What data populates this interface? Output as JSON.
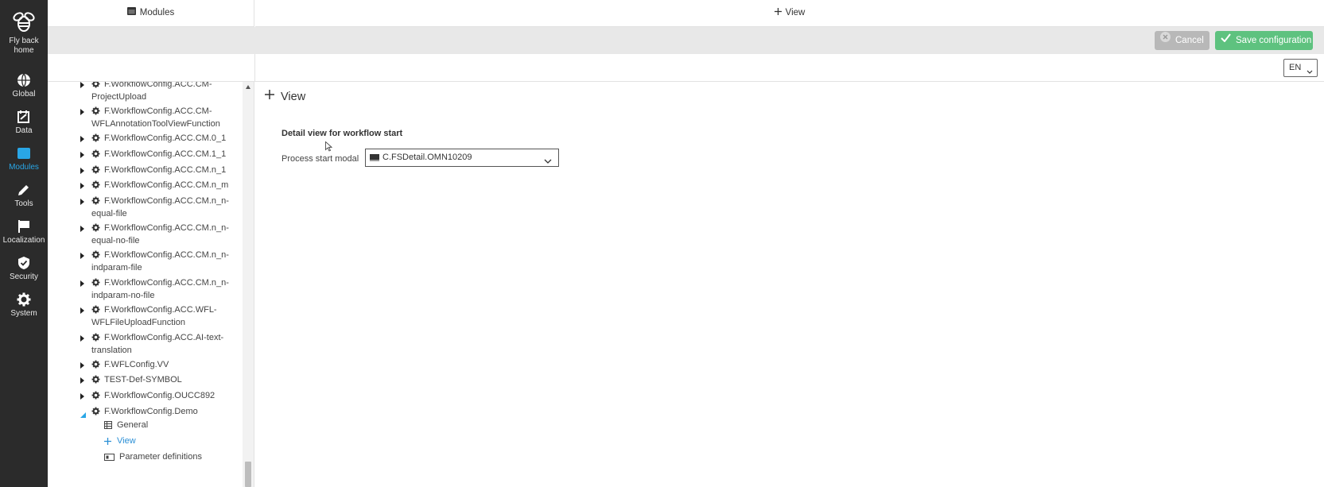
{
  "rail": {
    "items": [
      {
        "label": "Fly back home",
        "icon": "bee-logo-icon"
      },
      {
        "label": "Global",
        "icon": "globe-icon"
      },
      {
        "label": "Data",
        "icon": "edit-document-icon"
      },
      {
        "label": "Modules",
        "icon": "modules-window-icon",
        "active": true
      },
      {
        "label": "Tools",
        "icon": "pencil-icon"
      },
      {
        "label": "Localization",
        "icon": "flag-icon"
      },
      {
        "label": "Security",
        "icon": "shield-icon"
      },
      {
        "label": "System",
        "icon": "gear-icon"
      }
    ]
  },
  "tabs": {
    "left": "Modules",
    "right": "View"
  },
  "actions": {
    "cancel": "Cancel",
    "save": "Save configuration"
  },
  "language": "EN",
  "tree": {
    "nodes": [
      {
        "lines": [
          "F.WorkflowConfig.ACC.CM-",
          "ProjectUpload"
        ]
      },
      {
        "lines": [
          "F.WorkflowConfig.ACC.CM-",
          "WFLAnnotationToolViewFunction"
        ]
      },
      {
        "lines": [
          "F.WorkflowConfig.ACC.CM.0_1"
        ]
      },
      {
        "lines": [
          "F.WorkflowConfig.ACC.CM.1_1"
        ]
      },
      {
        "lines": [
          "F.WorkflowConfig.ACC.CM.n_1"
        ]
      },
      {
        "lines": [
          "F.WorkflowConfig.ACC.CM.n_m"
        ]
      },
      {
        "lines": [
          "F.WorkflowConfig.ACC.CM.n_n-",
          "equal-file"
        ]
      },
      {
        "lines": [
          "F.WorkflowConfig.ACC.CM.n_n-",
          "equal-no-file"
        ]
      },
      {
        "lines": [
          "F.WorkflowConfig.ACC.CM.n_n-",
          "indparam-file"
        ]
      },
      {
        "lines": [
          "F.WorkflowConfig.ACC.CM.n_n-",
          "indparam-no-file"
        ]
      },
      {
        "lines": [
          "F.WorkflowConfig.ACC.WFL-",
          "WFLFileUploadFunction"
        ]
      },
      {
        "lines": [
          "F.WorkflowConfig.ACC.AI-text-",
          "translation"
        ]
      },
      {
        "lines": [
          "F.WFLConfig.VV"
        ]
      },
      {
        "lines": [
          "TEST-Def-SYMBOL"
        ]
      },
      {
        "lines": [
          "F.WorkflowConfig.OUCC892"
        ]
      },
      {
        "lines": [
          "F.WorkflowConfig.Demo"
        ],
        "expanded": true
      }
    ],
    "children": [
      {
        "label": "General",
        "icon": "table-icon"
      },
      {
        "label": "View",
        "icon": "plus-icon",
        "selected": true
      },
      {
        "label": "Parameter definitions",
        "icon": "parameter-icon"
      }
    ]
  },
  "main": {
    "title": "View",
    "section_title": "Detail view for workflow start",
    "field_label": "Process start modal",
    "field_value": "C.FSDetail.OMN10209"
  },
  "colors": {
    "rail_bg": "#2b2b2b",
    "accent": "#29a6e6",
    "save": "#5ec27f",
    "cancel": "#b8b8b8"
  }
}
